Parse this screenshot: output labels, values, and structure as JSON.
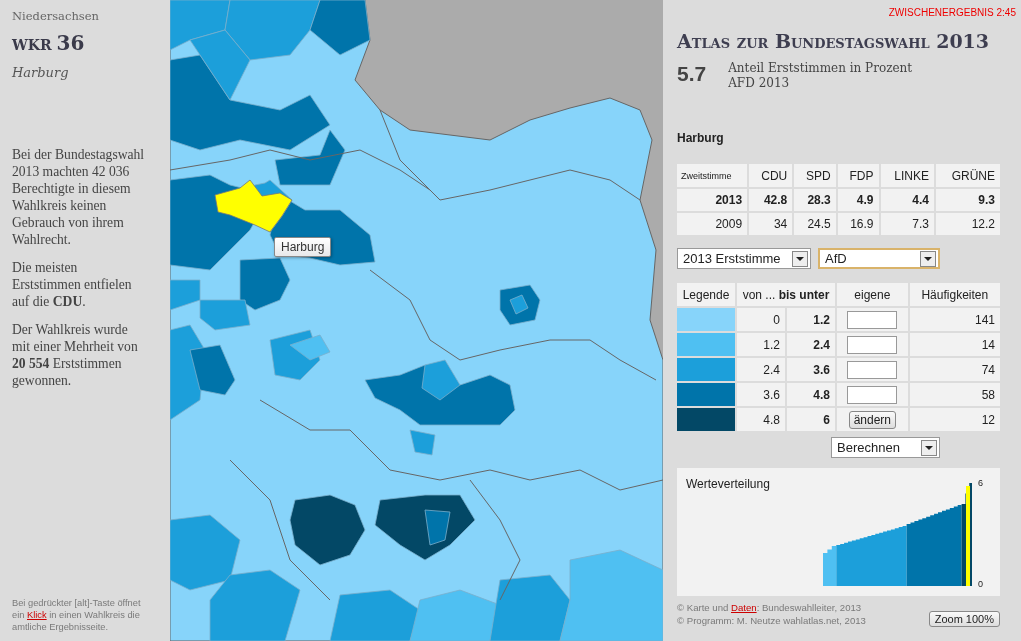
{
  "left": {
    "state": "Niedersachsen",
    "wkr_label": "WKR",
    "wkr_number": "36",
    "district": "Harburg",
    "paragraphs": [
      "Bei der Bundestagswahl 2013 machten 42 036 Berechtigte in diesem Wahlkreis keinen Gebrauch von ihrem Wahlrecht.",
      "Die meisten Erststimmen entfielen auf die **CDU**.",
      "Der Wahlkreis wurde mit einer Mehrheit von **20 554** Erststimmen gewonnen."
    ],
    "hint": {
      "before": "Bei gedrückter [alt]-Taste öffnet ein",
      "link": "Klick",
      "after": "in einen Wahlkreis die amtliche Ergebnisseite."
    }
  },
  "map": {
    "tooltip": "Harburg"
  },
  "right": {
    "status": "ZWISCHENERGEBNIS 2:45",
    "title": "Atlas zur Bundestagswahl 2013",
    "value": "5.7",
    "value_label": "Anteil Erststimmen in Prozent",
    "value_sub": "AFD 2013",
    "district": "Harburg",
    "results": {
      "columns": [
        "Zweitstimme",
        "CDU",
        "SPD",
        "FDP",
        "LINKE",
        "GRÜNE"
      ],
      "rows": [
        {
          "cells": [
            "2013",
            "42.8",
            "28.3",
            "4.9",
            "4.4",
            "9.3"
          ],
          "bold": true
        },
        {
          "cells": [
            "2009",
            "34",
            "24.5",
            "16.9",
            "7.3",
            "12.2"
          ],
          "bold": false
        }
      ]
    },
    "selects": [
      {
        "value": "2013 Erststimme",
        "focused": false
      },
      {
        "value": "AfD",
        "focused": true
      }
    ],
    "legend": {
      "columns": [
        "Legende",
        "von ... **bis unter**",
        "eigene",
        "Häufigkeiten"
      ],
      "rows": [
        {
          "color": "#87d4fa",
          "from": "0",
          "to": "1.2",
          "kind": "input",
          "count": "141"
        },
        {
          "color": "#4fc0f2",
          "from": "1.2",
          "to": "2.4",
          "kind": "input",
          "count": "14"
        },
        {
          "color": "#1c9fda",
          "from": "2.4",
          "to": "3.6",
          "kind": "input",
          "count": "74"
        },
        {
          "color": "#0074aa",
          "from": "3.6",
          "to": "4.8",
          "kind": "input",
          "count": "58"
        },
        {
          "color": "#034866",
          "from": "4.8",
          "to": "6",
          "kind": "button",
          "button": "ändern",
          "count": "12"
        }
      ]
    },
    "method_select": "Berechnen",
    "distribution": {
      "title": "Werteverteilung",
      "max_label": "6",
      "min_label": "0"
    },
    "credits": {
      "before": "© Karte und",
      "link": "Daten",
      "after": ": Bundeswahlleiter, 2013",
      "line2": "© Programm: M. Neutze wahlatlas.net, 2013"
    },
    "zoom_button": "Zoom 100%"
  }
}
